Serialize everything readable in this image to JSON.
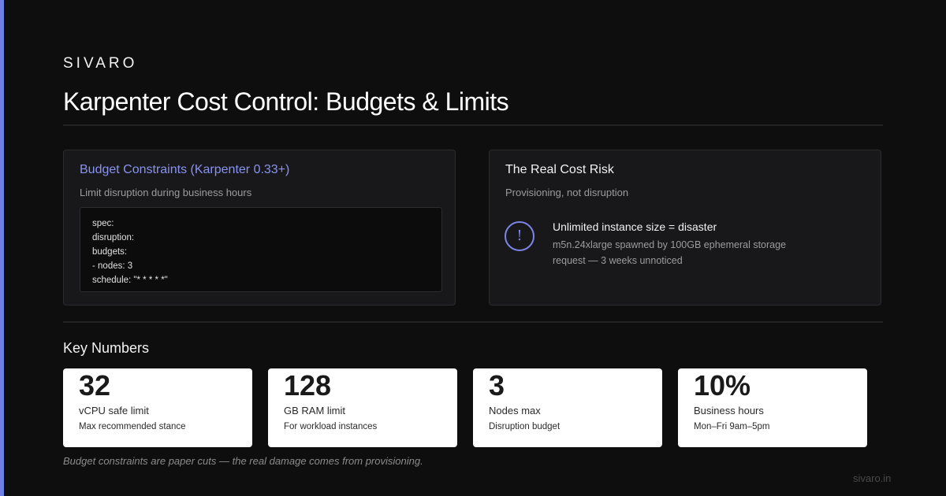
{
  "brand": "SIVARO",
  "title": "Karpenter Cost Control: Budgets & Limits",
  "budget_card": {
    "title": "Budget Constraints (Karpenter 0.33+)",
    "subtitle": "Limit disruption during business hours",
    "code_lines": [
      "spec:",
      "disruption:",
      "budgets:",
      "- nodes: 3",
      "schedule: \"* * * * *\""
    ]
  },
  "risk_card": {
    "title": "The Real Cost Risk",
    "subtitle": "Provisioning, not disruption",
    "icon": "!",
    "heading": "Unlimited instance size = disaster",
    "detail": "m5n.24xlarge spawned by 100GB ephemeral storage request — 3 weeks unnoticed"
  },
  "key_numbers": {
    "title": "Key Numbers",
    "items": [
      {
        "value": "32",
        "label": "vCPU safe limit",
        "desc": "Max recommended stance"
      },
      {
        "value": "128",
        "label": "GB RAM limit",
        "desc": "For workload instances"
      },
      {
        "value": "3",
        "label": "Nodes max",
        "desc": "Disruption budget"
      },
      {
        "value": "10%",
        "label": "Business hours",
        "desc": "Mon–Fri 9am–5pm"
      }
    ]
  },
  "footnote": "Budget constraints are paper cuts — the real damage comes from provisioning.",
  "domain": "sivaro.in",
  "colors": {
    "accent": "#6f7fe6",
    "background": "#0e0e0e",
    "card": "#18181a"
  }
}
